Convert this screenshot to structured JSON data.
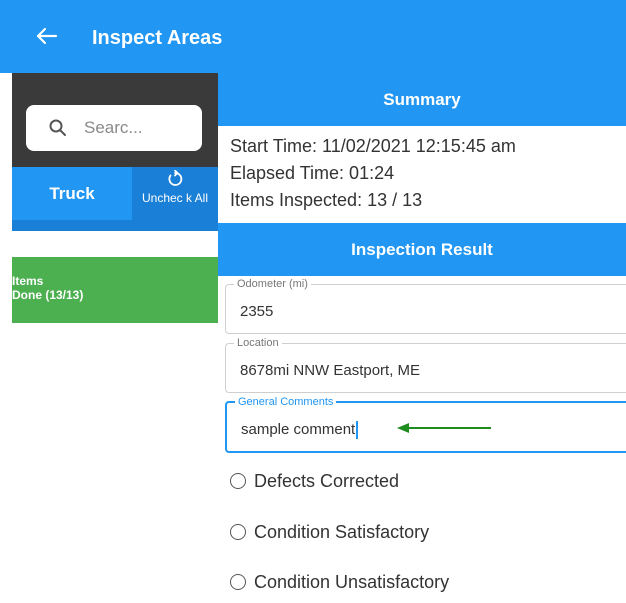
{
  "appbar": {
    "title": "Inspect Areas",
    "back_icon": "back-arrow-icon"
  },
  "sidebar": {
    "search_placeholder": "Searc...",
    "truck_tab": "Truck",
    "uncheck_label": "Unchec k All",
    "items_title": "Items",
    "items_count": "Done (13/13)"
  },
  "summary": {
    "header": "Summary",
    "start_time": "Start Time: 11/02/2021 12:15:45 am",
    "elapsed_time": "Elapsed Time: 01:24",
    "items_inspected": "Items Inspected: 13 / 13"
  },
  "result": {
    "header": "Inspection Result",
    "odometer_label": "Odometer (mi)",
    "odometer_value": "2355",
    "location_label": "Location",
    "location_value": "8678mi NNW Eastport, ME",
    "comments_label": "General Comments",
    "comments_value": "sample comment",
    "options": [
      "Defects Corrected",
      "Condition Satisfactory",
      "Condition Unsatisfactory"
    ]
  },
  "colors": {
    "primary": "#2196F3",
    "success": "#4CAF50",
    "dark": "#3a3a3a",
    "annotation": "#1e8c1e"
  }
}
